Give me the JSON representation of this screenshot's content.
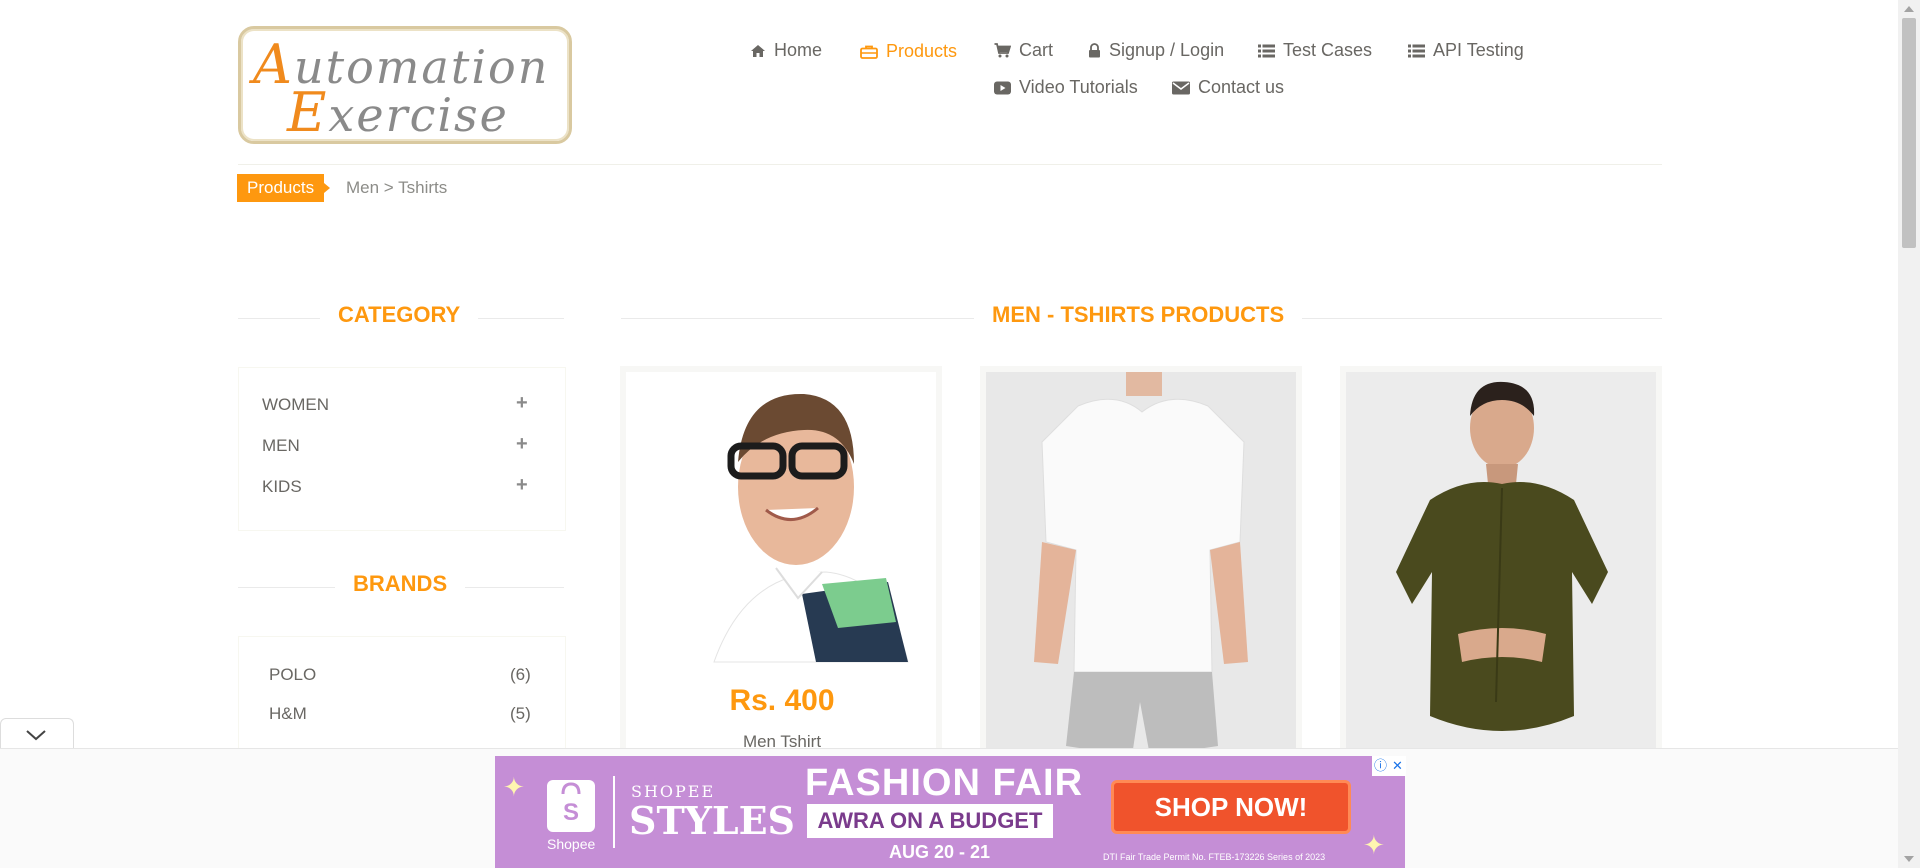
{
  "logo": {
    "line1_cap": "A",
    "line1_rest": "utomation",
    "line2_cap": "E",
    "line2_rest": "xercise"
  },
  "nav": [
    {
      "label": "Home",
      "icon": "home-icon"
    },
    {
      "label": "Products",
      "icon": "briefcase-icon",
      "active": true
    },
    {
      "label": "Cart",
      "icon": "cart-icon"
    },
    {
      "label": "Signup / Login",
      "icon": "lock-icon"
    },
    {
      "label": "Test Cases",
      "icon": "list-icon"
    },
    {
      "label": "API Testing",
      "icon": "list-icon"
    },
    {
      "label": "Video Tutorials",
      "icon": "youtube-icon"
    },
    {
      "label": "Contact us",
      "icon": "envelope-icon"
    }
  ],
  "breadcrumb": {
    "badge": "Products",
    "path": "Men > Tshirts"
  },
  "sidebar": {
    "category_title": "Category",
    "categories": [
      {
        "label": "WOMEN",
        "toggle": "+"
      },
      {
        "label": "MEN",
        "toggle": "+"
      },
      {
        "label": "KIDS",
        "toggle": "+"
      }
    ],
    "brands_title": "Brands",
    "brands": [
      {
        "label": "POLO",
        "count": "(6)"
      },
      {
        "label": "H&M",
        "count": "(5)"
      }
    ]
  },
  "main": {
    "title": "Men - Tshirts Products",
    "products": [
      {
        "price": "Rs. 400",
        "name": "Men Tshirt"
      },
      {
        "price": "",
        "name": ""
      },
      {
        "price": "",
        "name": ""
      }
    ]
  },
  "ad": {
    "shopee": "Shopee",
    "brand_top": "SHOPEE",
    "brand_main": "STYLES",
    "headline": "FASHION FAIR",
    "ribbon": "AWRA ON A BUDGET",
    "dates": "AUG 20 - 21",
    "cta": "SHOP NOW!",
    "permit": "DTI Fair Trade Permit No. FTEB-173226 Series of 2023",
    "info_glyph": "ⓘ",
    "close_glyph": "✕",
    "bg_color": "#c58ed6"
  },
  "colors": {
    "accent": "#fe980f",
    "text": "#696763"
  }
}
